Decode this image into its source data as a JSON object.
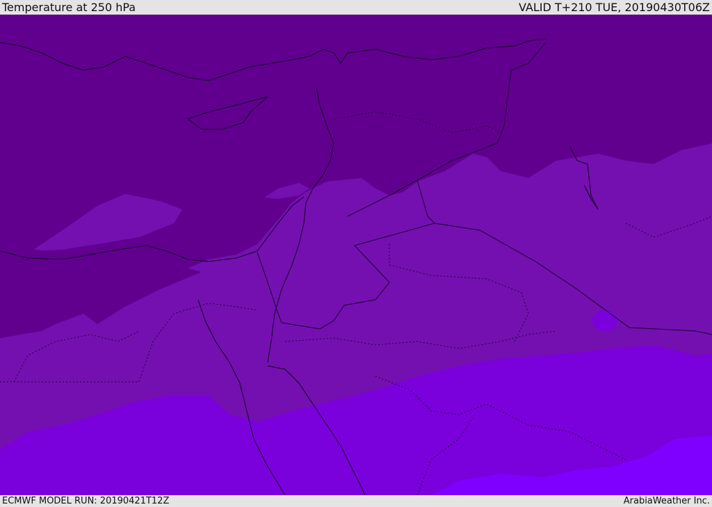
{
  "header": {
    "title": "Temperature at 250 hPa",
    "valid_time": "VALID T+210 TUE, 20190430T06Z"
  },
  "footer": {
    "model_run": "ECMWF MODEL RUN: 20190421T12Z",
    "credit": "ArabiaWeather Inc."
  },
  "map": {
    "colors": {
      "coldest_band": "#61008f",
      "cold_band": "#7410b0",
      "mid_band": "#7a00dc",
      "warm_band": "#7f00ff",
      "border_line": "#1a0030"
    }
  }
}
